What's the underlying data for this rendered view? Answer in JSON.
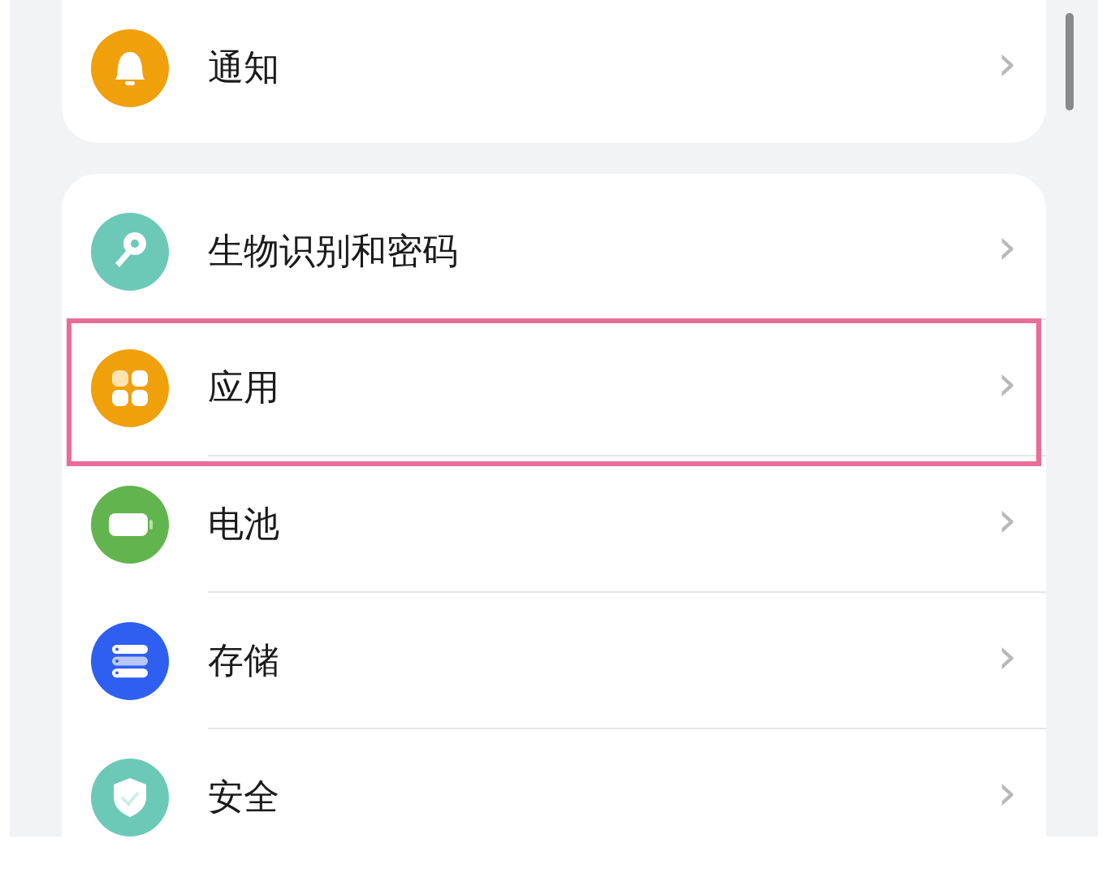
{
  "groups": [
    {
      "items": [
        {
          "kind": "bell",
          "color": "#f0a00a",
          "label": "通知",
          "chevron": "›",
          "highlighted": false
        }
      ]
    },
    {
      "items": [
        {
          "kind": "key",
          "color": "#6cc9b8",
          "label": "生物识别和密码",
          "chevron": "›",
          "highlighted": false
        },
        {
          "kind": "apps",
          "color": "#f0a00a",
          "label": "应用",
          "chevron": "›",
          "highlighted": true
        },
        {
          "kind": "battery",
          "color": "#62b44f",
          "label": "电池",
          "chevron": "›",
          "highlighted": false
        },
        {
          "kind": "storage",
          "color": "#2f5ff0",
          "label": "存储",
          "chevron": "›",
          "highlighted": false
        },
        {
          "kind": "shield",
          "color": "#6cc9b8",
          "label": "安全",
          "chevron": "›",
          "highlighted": false
        }
      ]
    }
  ]
}
